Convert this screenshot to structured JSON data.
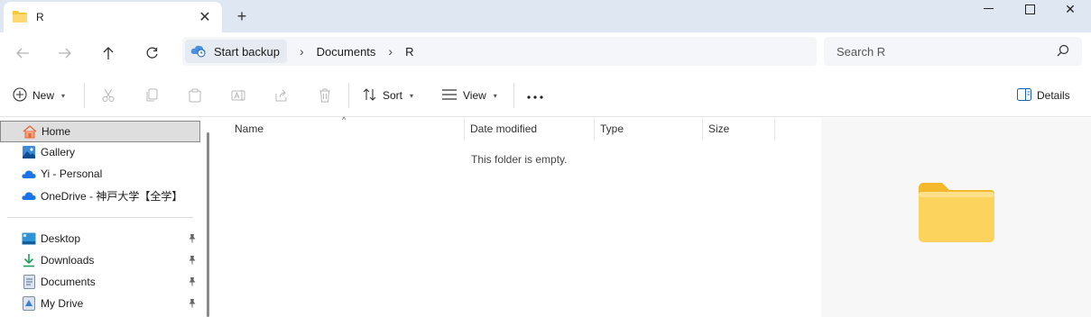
{
  "tab": {
    "title": "R"
  },
  "address": {
    "first_crumb": "Start backup",
    "crumbs": [
      "Documents",
      "R"
    ]
  },
  "search": {
    "placeholder": "Search R"
  },
  "command_bar": {
    "new_label": "New",
    "sort_label": "Sort",
    "view_label": "View",
    "details_label": "Details"
  },
  "sidebar": {
    "items": [
      {
        "label": "Home",
        "icon": "home-icon",
        "selected": true
      },
      {
        "label": "Gallery",
        "icon": "gallery-icon"
      },
      {
        "label": "Yi - Personal",
        "icon": "onedrive-icon"
      },
      {
        "label": "OneDrive - 神戸大学【全学】",
        "icon": "onedrive-icon"
      }
    ],
    "pinned": [
      {
        "label": "Desktop",
        "icon": "desktop-icon"
      },
      {
        "label": "Downloads",
        "icon": "download-icon"
      },
      {
        "label": "Documents",
        "icon": "documents-icon"
      },
      {
        "label": "My Drive",
        "icon": "drive-icon"
      }
    ]
  },
  "columns": [
    "Name",
    "Date modified",
    "Type",
    "Size"
  ],
  "empty_message": "This folder is empty.",
  "colors": {
    "accent": "#005fb8",
    "folder": "#f8c93b",
    "onedrive": "#1a73e8"
  }
}
